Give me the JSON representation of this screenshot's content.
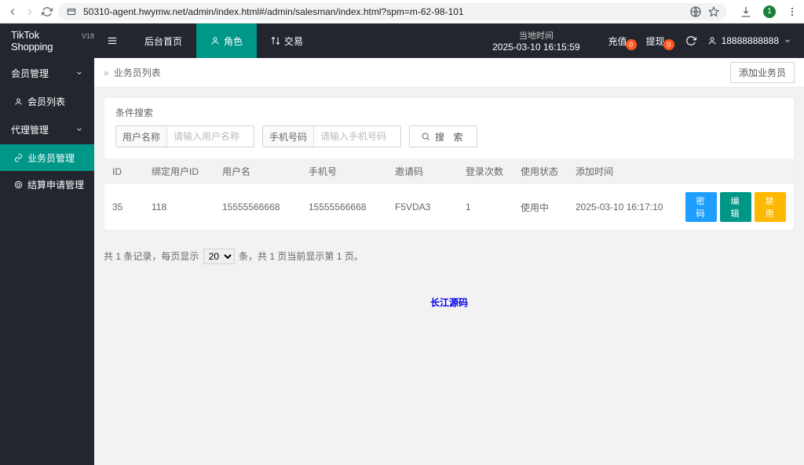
{
  "browser": {
    "url": "50310-agent.hwymw.net/admin/index.html#/admin/salesman/index.html?spm=m-62-98-101",
    "badge": "1"
  },
  "header": {
    "logo": "TikTok Shopping",
    "logo_sup": "V18",
    "tabs": {
      "home": "后台首页",
      "role": "角色",
      "trade": "交易"
    },
    "time_label": "当地时间",
    "time_value": "2025-03-10 16:15:59",
    "recharge": "充值",
    "recharge_badge": "0",
    "withdraw": "提现",
    "withdraw_badge": "0",
    "username": "18888888888"
  },
  "sidebar": {
    "group1": "会员管理",
    "item_member_list": "会员列表",
    "group2": "代理管理",
    "item_salesman": "业务员管理",
    "item_settlement": "结算申请管理"
  },
  "breadcrumb": {
    "current": "业务员列表",
    "add_btn": "添加业务员"
  },
  "search": {
    "title": "条件搜索",
    "username_label": "用户名称",
    "username_placeholder": "请输入用户名称",
    "phone_label": "手机号码",
    "phone_placeholder": "请输入手机号码",
    "search_btn": "搜 索"
  },
  "table": {
    "headers": {
      "id": "ID",
      "bind_uid": "绑定用户ID",
      "username": "用户名",
      "phone": "手机号",
      "invite": "邀请码",
      "login_count": "登录次数",
      "status": "使用状态",
      "add_time": "添加时间"
    },
    "rows": [
      {
        "id": "35",
        "bind_uid": "118",
        "username": "15555566668",
        "phone": "15555566668",
        "invite": "F5VDA3",
        "login_count": "1",
        "status": "使用中",
        "add_time": "2025-03-10 16:17:10"
      }
    ],
    "btns": {
      "pwd": "密 码",
      "edit": "编 辑",
      "disable": "禁 用"
    }
  },
  "pager": {
    "prefix": "共 1 条记录，每页显示",
    "page_size": "20",
    "suffix": "条，共 1 页当前显示第 1 页。"
  },
  "watermark": "长江源码"
}
